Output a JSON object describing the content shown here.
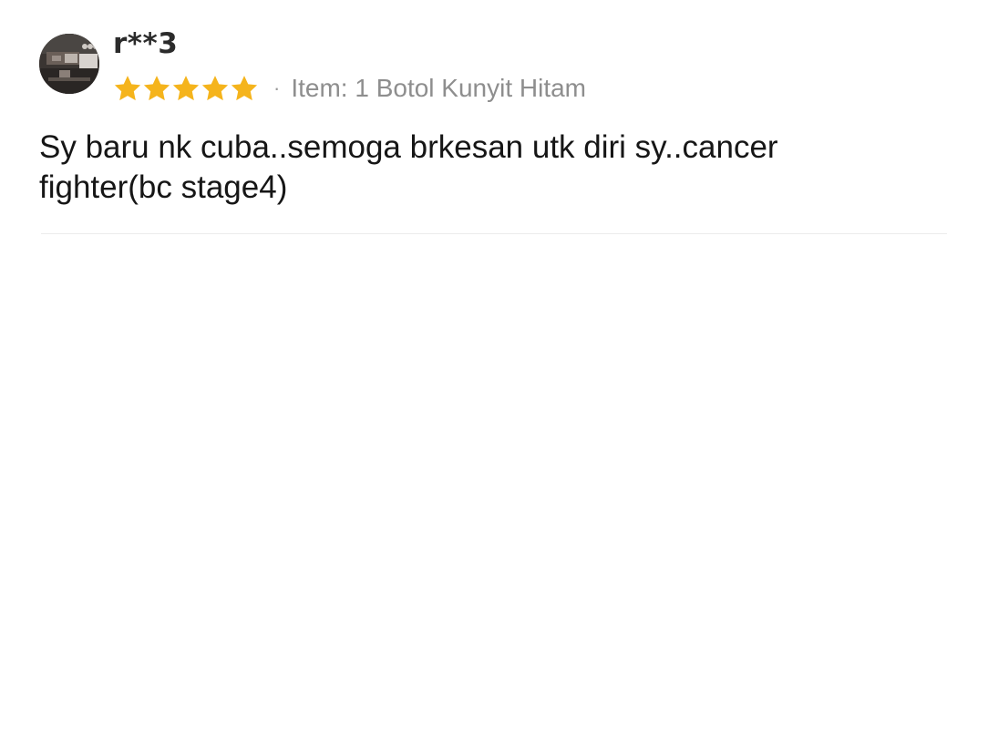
{
  "review": {
    "username": "r**3",
    "rating": 5,
    "rating_max": 5,
    "separator": "·",
    "item_label": "Item: 1 Botol Kunyit Hitam",
    "text": "Sy baru nk cuba..semoga brkesan utk diri sy..cancer fighter(bc stage4)"
  },
  "colors": {
    "star": "#f5b41c",
    "text": "#161616",
    "muted": "#8e8e8e",
    "divider": "#ececec"
  },
  "icons": {
    "avatar": "user-avatar-photo",
    "star": "star-icon"
  }
}
